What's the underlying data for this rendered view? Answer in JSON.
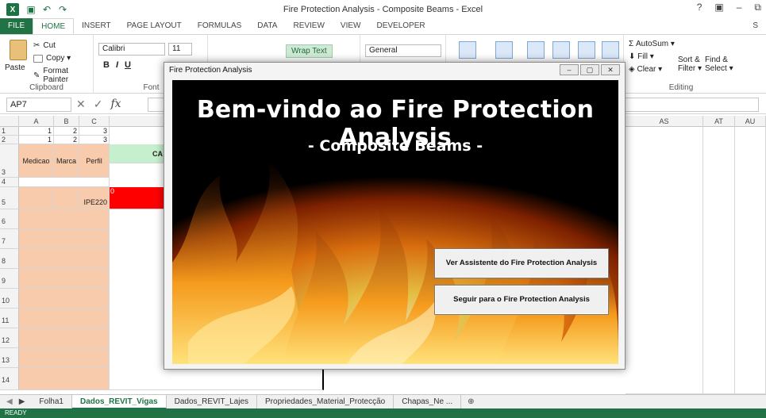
{
  "window": {
    "title": "Fire Protection Analysis - Composite Beams - Excel",
    "controls": [
      "?",
      "▣",
      "–",
      "⧉"
    ]
  },
  "ribbon_tabs": [
    "FILE",
    "HOME",
    "INSERT",
    "PAGE LAYOUT",
    "FORMULAS",
    "DATA",
    "REVIEW",
    "VIEW",
    "DEVELOPER"
  ],
  "ribbon_right_letter": "S",
  "clipboard": {
    "paste": "Paste",
    "cut": "Cut",
    "copy": "Copy ▾",
    "format_painter": "Format Painter",
    "group": "Clipboard"
  },
  "font": {
    "name": "Calibri",
    "size": "11",
    "group": "Font",
    "bold": "B",
    "italic": "I",
    "underline": "U"
  },
  "alignment": {
    "wrap_text": "Wrap Text"
  },
  "number": {
    "format": "General"
  },
  "editing": {
    "autosum": "AutoSum ▾",
    "fill": "Fill ▾",
    "clear": "Clear ▾",
    "sort_filter": "Sort & Filter ▾",
    "find_select": "Find & Select ▾",
    "group": "Editing"
  },
  "formula_bar": {
    "name_box": "AP7",
    "fx": "fx"
  },
  "columns": [
    "A",
    "B",
    "C",
    "AS",
    "AT",
    "AU"
  ],
  "rows": {
    "r1": [
      "1",
      "2",
      "3"
    ],
    "r2": [
      "1",
      "2",
      "3"
    ],
    "header": [
      "Medicao",
      "Marca",
      "Perfil"
    ],
    "partial_header": "CA",
    "r5_profile": "IPE220",
    "r5_marker": "0",
    "numbers": [
      "1",
      "2",
      "3",
      "4",
      "5",
      "6",
      "7",
      "8",
      "9",
      "10",
      "11",
      "12",
      "13",
      "14"
    ]
  },
  "sheet_tabs": [
    "Folha1",
    "Dados_REVIT_Vigas",
    "Dados_REVIT_Lajes",
    "Propriedades_Material_Protecção",
    "Chapas_Ne ..."
  ],
  "status": "READY",
  "dialog": {
    "title": "Fire Protection Analysis",
    "heading": "Bem-vindo ao Fire Protection Analysis",
    "subheading": "- Composite Beams -",
    "btn_assistant": "Ver Assistente do Fire Protection Analysis",
    "btn_continue": "Seguir para o Fire Protection Analysis"
  }
}
